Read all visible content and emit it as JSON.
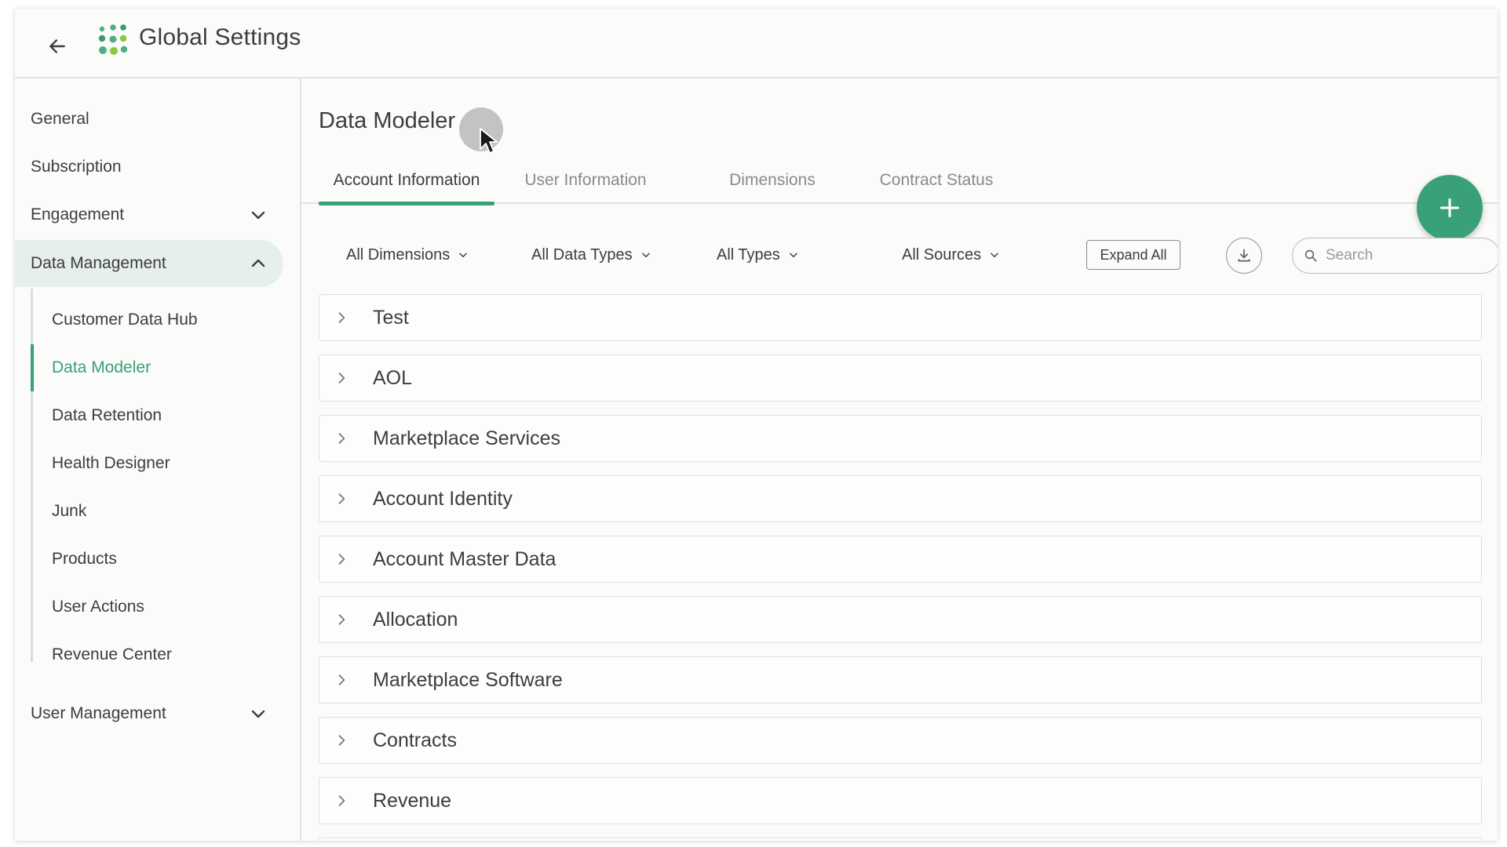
{
  "header": {
    "title": "Global Settings"
  },
  "sidebar": {
    "items": [
      {
        "label": "General"
      },
      {
        "label": "Subscription"
      },
      {
        "label": "Engagement"
      },
      {
        "label": "Data Management"
      },
      {
        "label": "User Management"
      }
    ],
    "data_management_children": [
      {
        "label": "Customer Data Hub"
      },
      {
        "label": "Data Modeler"
      },
      {
        "label": "Data Retention"
      },
      {
        "label": "Health Designer"
      },
      {
        "label": "Junk"
      },
      {
        "label": "Products"
      },
      {
        "label": "User Actions"
      },
      {
        "label": "Revenue Center"
      }
    ],
    "active_child": "Data Modeler"
  },
  "main": {
    "title": "Data Modeler",
    "tabs": [
      {
        "label": "Account Information",
        "active": true
      },
      {
        "label": "User Information",
        "active": false
      },
      {
        "label": "Dimensions",
        "active": false
      },
      {
        "label": "Contract Status",
        "active": false
      }
    ],
    "filters": [
      {
        "label": "All Dimensions"
      },
      {
        "label": "All Data Types"
      },
      {
        "label": "All Types"
      },
      {
        "label": "All Sources"
      }
    ],
    "expand_all_label": "Expand All",
    "search_placeholder": "Search",
    "groups": [
      {
        "label": "Test"
      },
      {
        "label": "AOL"
      },
      {
        "label": "Marketplace Services"
      },
      {
        "label": "Account Identity"
      },
      {
        "label": "Account Master Data"
      },
      {
        "label": "Allocation"
      },
      {
        "label": "Marketplace Software"
      },
      {
        "label": "Contracts"
      },
      {
        "label": "Revenue"
      },
      {
        "label": ""
      }
    ]
  },
  "icons": {
    "back": "arrow-left-icon",
    "logo": "dots-logo-icon",
    "add": "plus-icon",
    "download": "download-icon",
    "search": "search-icon",
    "expand": "chevron-right-icon"
  },
  "colors": {
    "accent": "#3aa07a",
    "active_nav_bg": "#e6efe9",
    "text": "#3d3d3d",
    "muted_text": "#8a8a8a"
  }
}
